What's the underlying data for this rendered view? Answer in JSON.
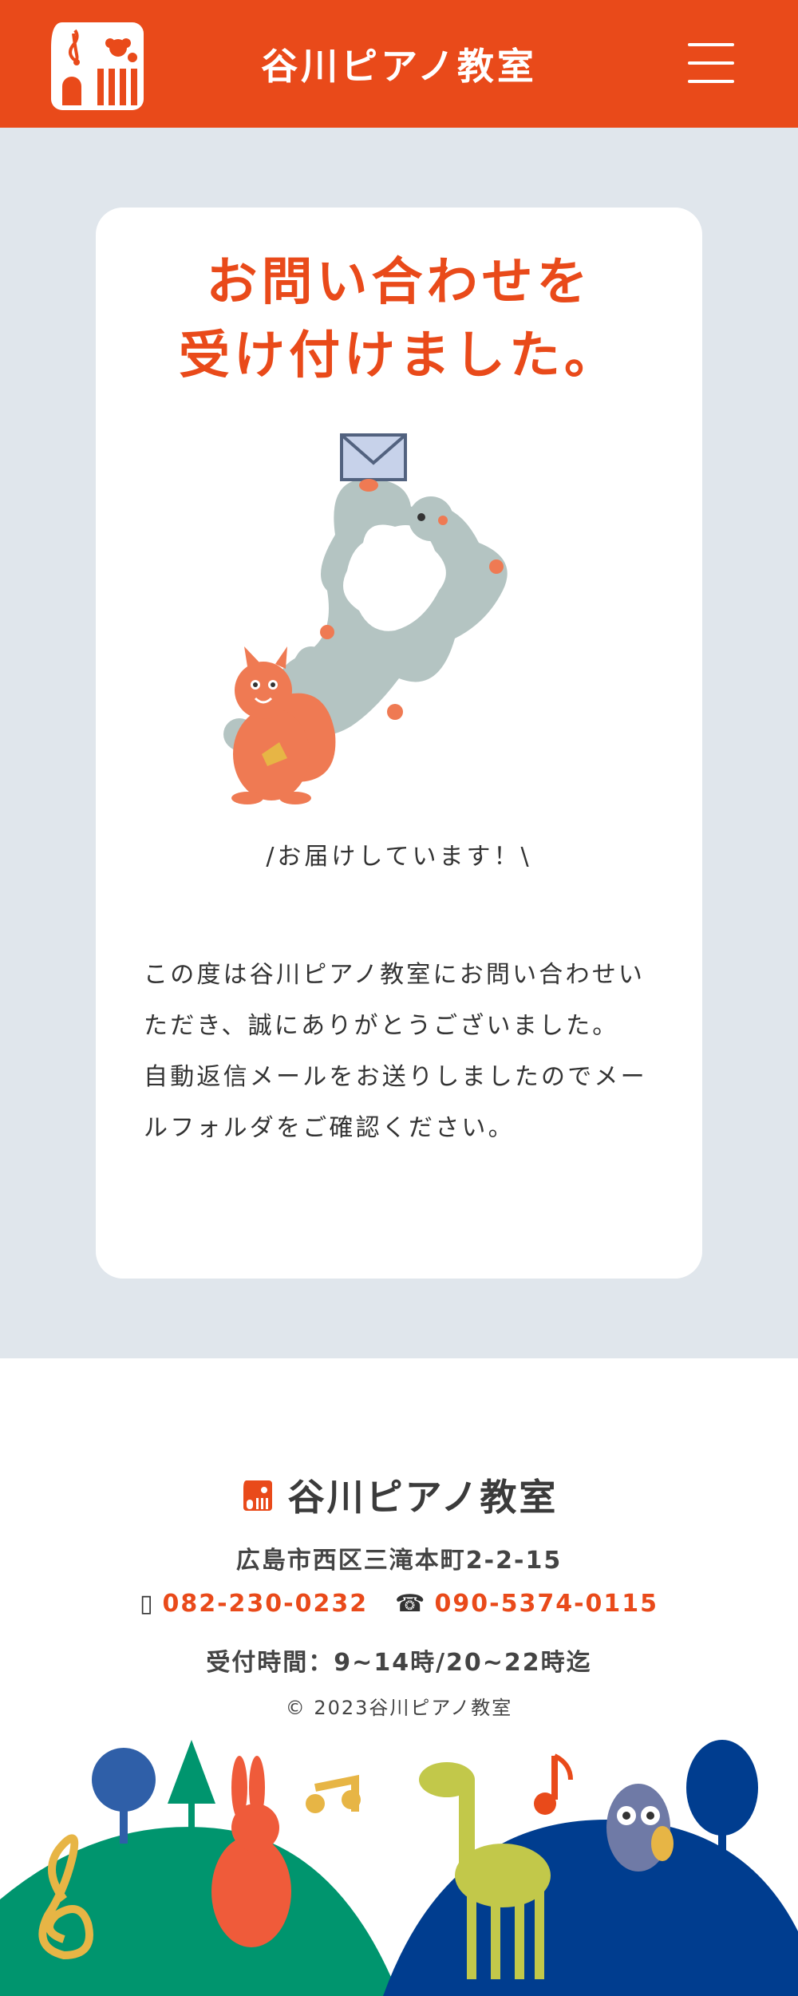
{
  "header": {
    "site_title": "谷川ピアノ教室",
    "menu_icon": "hamburger-menu-icon",
    "brand_color": "#e94a1a"
  },
  "card": {
    "title_line1": "お問い合わせを",
    "title_line2": "受け付けました。",
    "delivering": "/お届けしています！\\",
    "message_line1": "この度は谷川ピアノ教室にお問い合わせいただき、誠にありがとうございました。",
    "message_line2": "自動返信メールをお送りしましたのでメールフォルダをご確認ください。"
  },
  "footer": {
    "title": "谷川ピアノ教室",
    "address": "広島市西区三滝本町2-2-15",
    "phone1": "082-230-0232",
    "phone1_icon": "mobile-phone-icon",
    "phone2": "090-5374-0115",
    "phone2_icon": "telephone-icon",
    "hours": "受付時間：9~14時/20~22時迄",
    "copyright": "© 2023谷川ピアノ教室"
  },
  "colors": {
    "accent": "#e94a1a",
    "background_band": "#e0e6ec",
    "hill_green": "#00956e",
    "hill_blue": "#003d8f"
  }
}
